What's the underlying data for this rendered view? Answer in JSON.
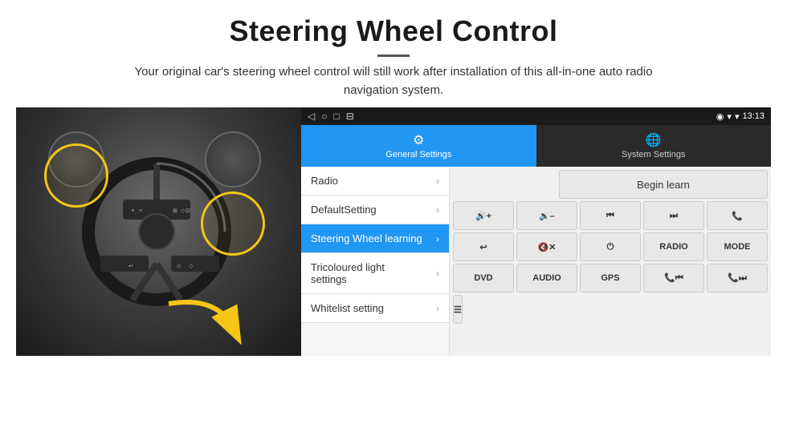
{
  "header": {
    "title": "Steering Wheel Control",
    "subtitle": "Your original car's steering wheel control will still work after installation of this all-in-one auto radio navigation system."
  },
  "statusBar": {
    "back": "◁",
    "home": "○",
    "recent": "□",
    "screenshot": "⊟",
    "signal": "▾",
    "wifi": "▾",
    "time": "13:13"
  },
  "tabs": {
    "general": {
      "label": "General Settings",
      "icon": "⚙"
    },
    "system": {
      "label": "System Settings",
      "icon": "🌐"
    }
  },
  "menu": {
    "items": [
      {
        "label": "Radio",
        "active": false
      },
      {
        "label": "DefaultSetting",
        "active": false
      },
      {
        "label": "Steering Wheel learning",
        "active": true
      },
      {
        "label": "Tricoloured light settings",
        "active": false
      },
      {
        "label": "Whitelist setting",
        "active": false
      }
    ]
  },
  "controls": {
    "begin_learn": "Begin learn",
    "buttons": [
      [
        {
          "type": "vol_up",
          "label": "🔊+"
        },
        {
          "type": "vol_dn",
          "label": "🔉-"
        },
        {
          "type": "prev",
          "label": "⏮"
        },
        {
          "type": "next",
          "label": "⏭"
        },
        {
          "type": "call",
          "label": "📞"
        }
      ],
      [
        {
          "type": "hang",
          "label": "↩"
        },
        {
          "type": "mute",
          "label": "🔇x"
        },
        {
          "type": "power",
          "label": "⏻"
        },
        {
          "type": "radio",
          "label": "RADIO"
        },
        {
          "type": "mode",
          "label": "MODE"
        }
      ],
      [
        {
          "type": "dvd",
          "label": "DVD"
        },
        {
          "type": "audio",
          "label": "AUDIO"
        },
        {
          "type": "gps",
          "label": "GPS"
        },
        {
          "type": "tel_prev",
          "label": "📞⏮"
        },
        {
          "type": "tel_next",
          "label": "📞⏭"
        }
      ],
      [
        {
          "type": "list",
          "label": "☰"
        }
      ]
    ]
  }
}
